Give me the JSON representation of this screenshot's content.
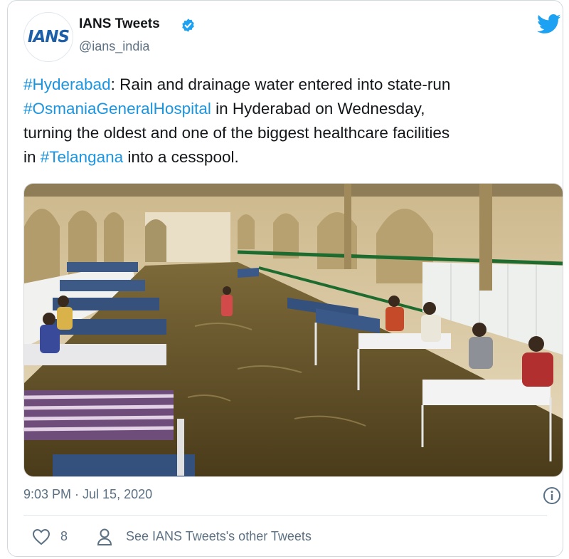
{
  "tweet": {
    "avatar_text": "IANS",
    "author_name": "IANS Tweets",
    "handle": "@ians_india",
    "text_lines": [
      [
        {
          "t": "#Hyderabad",
          "tag": true
        },
        {
          "t": ": Rain and drainage water entered into state-run",
          "tag": false
        }
      ],
      [
        {
          "t": "#OsmaniaGeneralHospital",
          "tag": true
        },
        {
          "t": " in Hyderabad on Wednesday,",
          "tag": false
        }
      ],
      [
        {
          "t": "turning the oldest and one of the biggest healthcare facilities",
          "tag": false
        }
      ],
      [
        {
          "t": "in ",
          "tag": false
        },
        {
          "t": "#Telangana",
          "tag": true
        },
        {
          "t": " into a cesspool.",
          "tag": false
        }
      ]
    ],
    "timestamp": "9:03 PM · Jul 15, 2020",
    "like_count": "8",
    "other_tweets_label": "See IANS Tweets's other Tweets"
  },
  "icons": {
    "twitter_bird": "twitter-bird-icon",
    "verified": "verified-badge-icon",
    "info": "info-icon",
    "like": "heart-icon",
    "profile": "person-icon"
  },
  "colors": {
    "link": "#1b95e0",
    "twitter_blue": "#1da1f2",
    "secondary_text": "#5b7083",
    "hospital_wall": "#d7c49a",
    "floodwater": "#5c4a22",
    "green_stripe": "#1e6b2f"
  }
}
